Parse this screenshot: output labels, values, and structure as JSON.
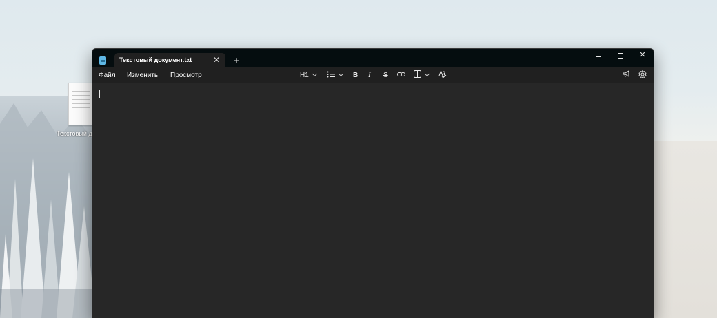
{
  "desktop": {
    "file_label": "Текстовый д"
  },
  "window": {
    "tab_title": "Текстовый документ.txt",
    "close_tab_glyph": "✕",
    "new_tab_glyph": "+",
    "close_glyph": "✕"
  },
  "menu": {
    "file": "Файл",
    "edit": "Изменить",
    "view": "Просмотр"
  },
  "toolbar": {
    "heading": "H1",
    "list_icon": "list-icon",
    "bold": "B",
    "italic": "I",
    "strike": "S",
    "link_icon": "link-icon",
    "table_icon": "table-icon",
    "spellcheck_icon": "spellcheck-icon",
    "notify_icon": "megaphone-icon",
    "settings_icon": "gear-icon"
  },
  "editor": {
    "content": ""
  },
  "colors": {
    "titlebar": "#050d0f",
    "surface": "#272727",
    "accent_dot": "#4cc2ff"
  }
}
